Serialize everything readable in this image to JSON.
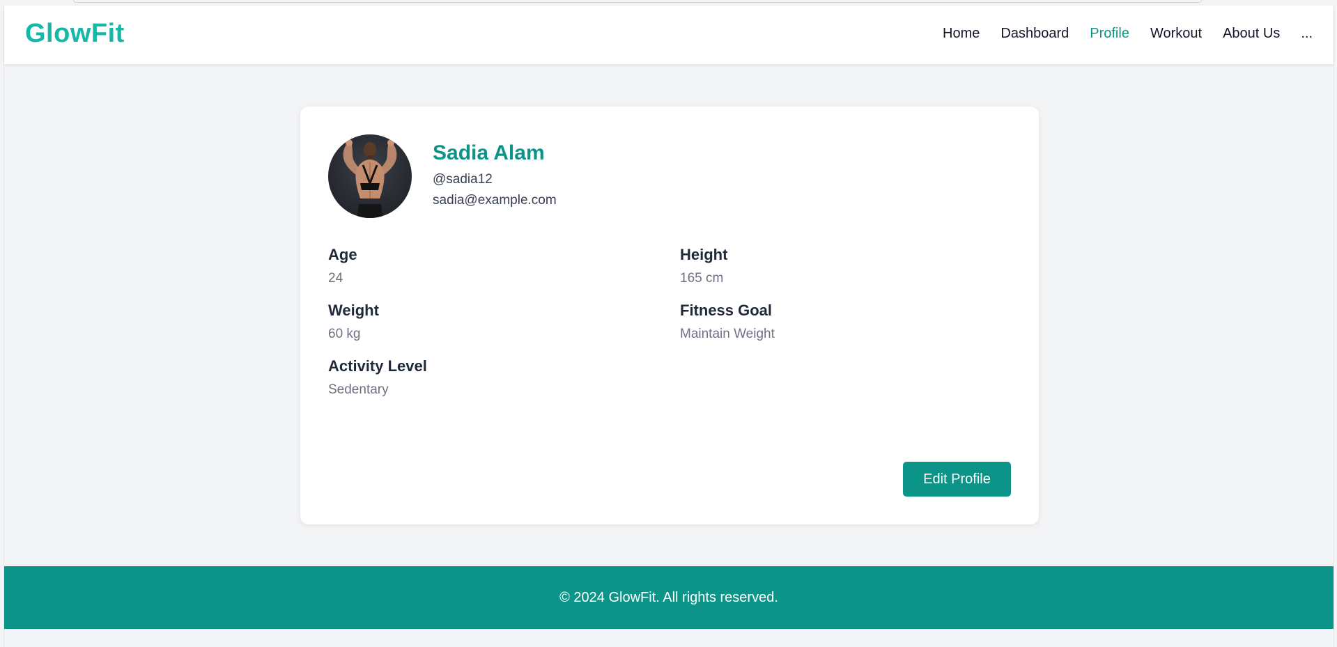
{
  "header": {
    "logo": "GlowFit",
    "nav": [
      {
        "label": "Home",
        "active": false
      },
      {
        "label": "Dashboard",
        "active": false
      },
      {
        "label": "Profile",
        "active": true
      },
      {
        "label": "Workout",
        "active": false
      },
      {
        "label": "About Us",
        "active": false
      },
      {
        "label": "...",
        "active": false
      }
    ]
  },
  "profile": {
    "name": "Sadia Alam",
    "username": "@sadia12",
    "email": "sadia@example.com",
    "avatar_icon": "user-avatar-photo",
    "fields": [
      {
        "label": "Age",
        "value": "24"
      },
      {
        "label": "Height",
        "value": "165 cm"
      },
      {
        "label": "Weight",
        "value": "60 kg"
      },
      {
        "label": "Fitness Goal",
        "value": "Maintain Weight"
      },
      {
        "label": "Activity Level",
        "value": "Sedentary"
      }
    ],
    "edit_label": "Edit Profile"
  },
  "footer": {
    "text": "© 2024 GlowFit. All rights reserved."
  },
  "colors": {
    "accent": "#0d9488",
    "logo": "#14b8a6",
    "background": "#f3f4f6"
  }
}
